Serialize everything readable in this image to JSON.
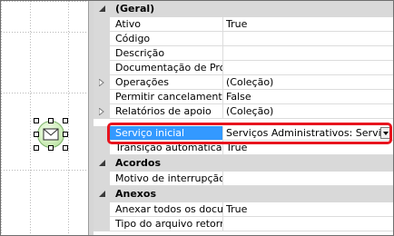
{
  "grid": {
    "categories": [
      {
        "label": "(Geral)",
        "rows": [
          {
            "name": "Ativo",
            "value": "True"
          },
          {
            "name": "Código",
            "value": ""
          },
          {
            "name": "Descrição",
            "value": ""
          },
          {
            "name": "Documentação de Proce",
            "value": ""
          },
          {
            "name": "Operações",
            "value": "(Coleção)",
            "expandable": true
          },
          {
            "name": "Permitir cancelamento pe",
            "value": "False"
          },
          {
            "name": "Relatórios de apoio",
            "value": "(Coleção)",
            "expandable": true
          },
          {
            "name": "Serviço inicial",
            "value": "Serviços Administrativos: Serviços d",
            "selected": true
          },
          {
            "name": "Transição automática",
            "value": "True"
          }
        ]
      },
      {
        "label": "Acordos",
        "rows": [
          {
            "name": "Motivo de interrupção de",
            "value": ""
          }
        ]
      },
      {
        "label": "Anexos",
        "rows": [
          {
            "name": "Anexar todos os docume",
            "value": "True"
          },
          {
            "name": "Tipo do arquivo retornad",
            "value": ""
          }
        ]
      }
    ]
  },
  "colors": {
    "selection": "#3399ff",
    "highlight_border": "#e8141e",
    "node_fill": "#cdecb8"
  },
  "icons": {
    "category_toggle": "collapse-triangle-icon",
    "row_expander": "expand-triangle-icon",
    "node": "envelope-icon",
    "dropdown": "chevron-down-icon"
  }
}
